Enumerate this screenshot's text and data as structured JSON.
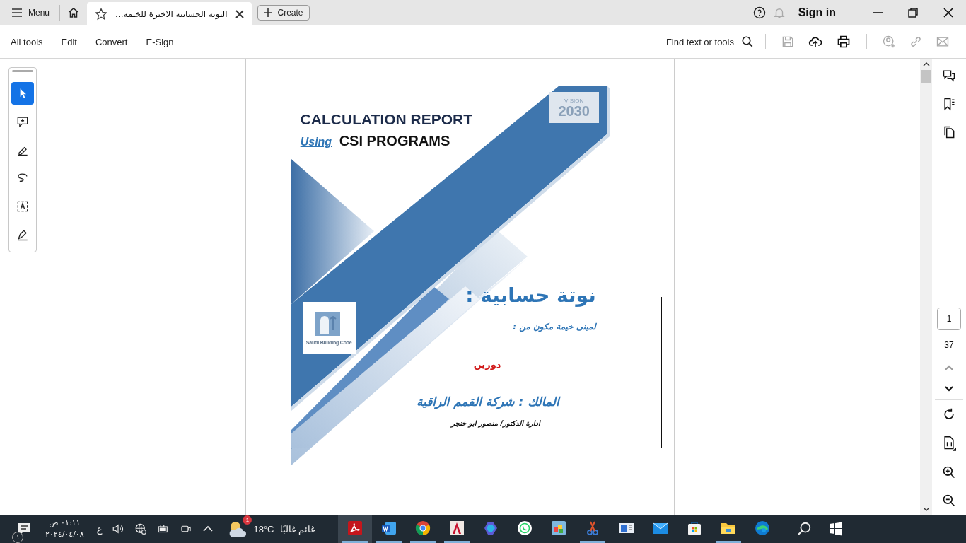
{
  "titlebar": {
    "menu": "Menu",
    "tab": {
      "title": "النوتة الحسابية الاخيرة للخيمة...",
      "selected": true
    },
    "create": "Create",
    "sign_in": "Sign in"
  },
  "toolbar": {
    "all_tools": "All tools",
    "edit": "Edit",
    "convert": "Convert",
    "e_sign": "E-Sign",
    "find": "Find text or tools"
  },
  "tools": [
    {
      "kind": "select",
      "selected": true
    },
    {
      "kind": "comment",
      "selected": false
    },
    {
      "kind": "highlight",
      "selected": false
    },
    {
      "kind": "draw",
      "selected": false
    },
    {
      "kind": "textselect",
      "selected": false
    },
    {
      "kind": "sign",
      "selected": false
    }
  ],
  "document": {
    "title": "CALCULATION REPORT",
    "using": "Using",
    "subtitle": "CSI PROGRAMS",
    "vision_logo": [
      "VISION",
      "2030"
    ],
    "sbc_logo": "Saudi Building Code",
    "heading": "نوتة حسابية :",
    "line_1": "لمبنى خيمة مكون من :",
    "floors": "دورين",
    "owner": "المالك : شركة القمم الراقية",
    "manager": "ادارة الدكتور/ منصور ابو خنجر"
  },
  "page_nav": {
    "current": "1",
    "total": "37"
  },
  "taskbar": {
    "notifications": "١",
    "time": "٠١:١١ ص",
    "date": "٢٠٢٤/٠٤/٠٨",
    "language": "ع",
    "weather": {
      "badge": "1",
      "temperature": "18°C",
      "condition": "غائم غالبًا"
    },
    "apps": [
      {
        "kind": "pdf",
        "running": true,
        "selected": true
      },
      {
        "kind": "word",
        "running": true,
        "selected": false
      },
      {
        "kind": "chrome",
        "running": true,
        "selected": false
      },
      {
        "kind": "cad",
        "running": true,
        "selected": false
      },
      {
        "kind": "copilot",
        "running": false,
        "selected": false
      },
      {
        "kind": "chat",
        "running": false,
        "selected": false
      },
      {
        "kind": "blocks",
        "running": false,
        "selected": false
      },
      {
        "kind": "scissors",
        "running": true,
        "selected": false
      },
      {
        "kind": "screen",
        "running": false,
        "selected": false
      },
      {
        "kind": "mail",
        "running": false,
        "selected": false
      },
      {
        "kind": "store",
        "running": false,
        "selected": false
      },
      {
        "kind": "folder",
        "running": true,
        "selected": false
      },
      {
        "kind": "edge",
        "running": false,
        "selected": false
      }
    ]
  }
}
